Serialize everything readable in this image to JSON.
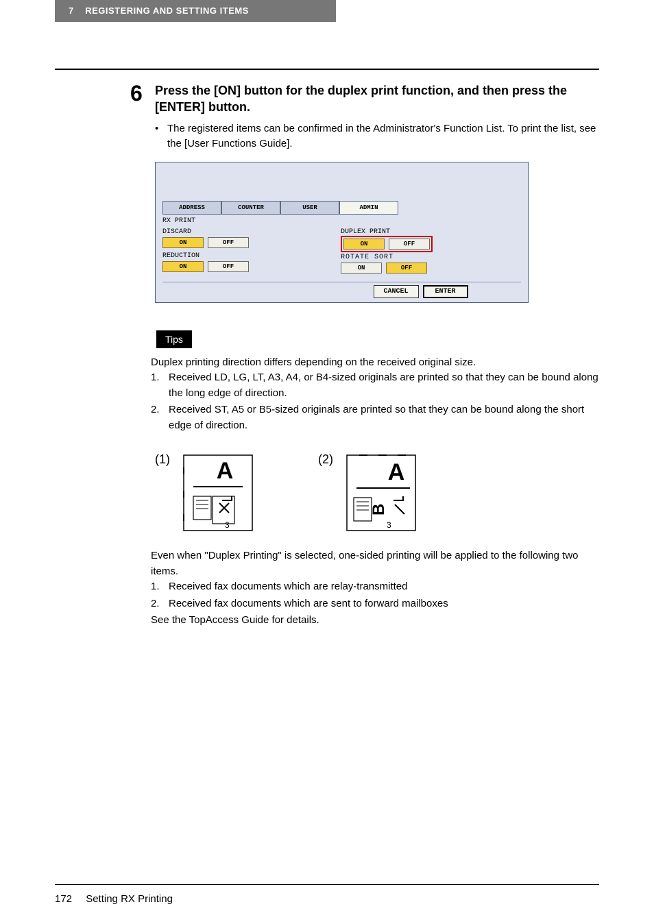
{
  "header": {
    "chapter_num": "7",
    "chapter_title": "REGISTERING AND SETTING ITEMS"
  },
  "step": {
    "number": "6",
    "title_line1": "Press the [ON] button for the duplex print function, and then press the [ENTER] button.",
    "bullet": "The registered items can be confirmed in the Administrator's Function List. To print the list, see the [User Functions Guide]."
  },
  "screen": {
    "tabs": {
      "address": "ADDRESS",
      "counter": "COUNTER",
      "user": "USER",
      "admin": "ADMIN"
    },
    "rx_print": "RX PRINT",
    "discard": "DISCARD",
    "reduction": "REDUCTION",
    "duplex_print": "DUPLEX PRINT",
    "rotate_sort": "ROTATE SORT",
    "on": "ON",
    "off": "OFF",
    "cancel": "CANCEL",
    "enter": "ENTER"
  },
  "tips": {
    "label": "Tips",
    "intro": "Duplex printing direction differs depending on the received original size.",
    "item1": "Received LD, LG, LT, A3, A4, or B4-sized originals are printed so that they can be bound along the long edge of direction.",
    "item2": "Received ST, A5 or B5-sized originals are printed so that they can be bound along the short edge of direction.",
    "diag1": "(1)",
    "diag2": "(2)",
    "note": "Even when \"Duplex Printing\" is selected, one-sided printing will be applied to the following two items.",
    "note_item1": "Received fax documents which are relay-transmitted",
    "note_item2": "Received fax documents which are sent to forward mailboxes",
    "closing": "See the TopAccess Guide for details."
  },
  "footer": {
    "page": "172",
    "title": "Setting RX Printing"
  }
}
